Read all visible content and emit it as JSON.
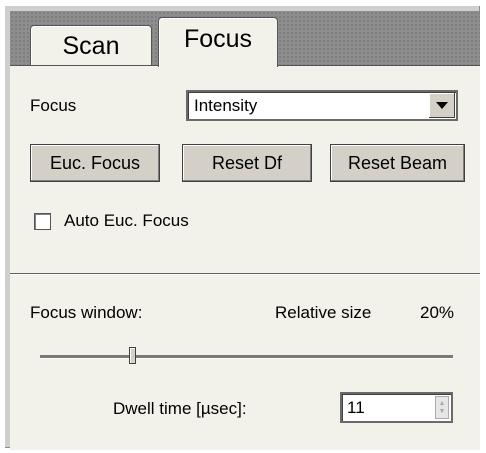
{
  "tabs": [
    {
      "label": "Scan",
      "active": false
    },
    {
      "label": "Focus",
      "active": true
    }
  ],
  "focus": {
    "label": "Focus",
    "selected": "Intensity"
  },
  "buttons": {
    "euc_focus": "Euc. Focus",
    "reset_df": "Reset Df",
    "reset_beam": "Reset Beam"
  },
  "auto_euc_focus": {
    "label": "Auto Euc. Focus",
    "checked": false
  },
  "focus_window": {
    "label": "Focus window:",
    "relative_size_label": "Relative size",
    "relative_size_value": "20%",
    "slider_fraction": 0.22
  },
  "dwell": {
    "label": "Dwell time [µsec]:",
    "value": "11"
  }
}
